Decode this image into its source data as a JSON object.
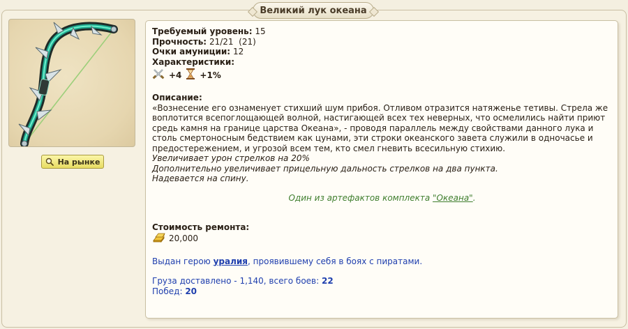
{
  "title": "Великий лук океана",
  "market_button": {
    "label": "На рынке"
  },
  "item": {
    "image_icon": "bow-icon",
    "required_level_label": "Требуемый уровень:",
    "required_level_value": "15",
    "durability_label": "Прочность:",
    "durability_value": "21/21  (21)",
    "ammo_label": "Очки амуниции:",
    "ammo_value": "12",
    "characteristics_label": "Характеристики:",
    "stats": [
      {
        "icon": "crossed-swords-icon",
        "value": "+4"
      },
      {
        "icon": "hourglass-icon",
        "value": "+1%"
      }
    ],
    "description_label": "Описание:",
    "description_text": "«Вознесение его ознаменует стихший шум прибоя. Отливом отразится натяженье тетивы. Стрела же воплотится всепоглощающей волной, настигающей всех тех неверных, что осмелились найти приют средь камня на границе царства Океана», - проводя параллель между свойствами данного лука и столь смертоносным бедствием как цунами, эти строки океанского завета служили в одночасье и предостережением, и угрозой всем тем, кто смел гневить всесильную стихию.",
    "effects": [
      "Увеличивает урон стрелков на 20%",
      "Дополнительно увеличивает прицельную дальность стрелков на два пункта.",
      "Надевается на спину."
    ],
    "set_prefix": "Один из артефактов комплекта ",
    "set_link": "\"Океана\"",
    "set_suffix": ".",
    "repair_label": "Стоимость ремонта:",
    "repair_icon": "gold-icon",
    "repair_value": "20,000",
    "issued_prefix": "Выдан герою ",
    "issued_hero": "уралия",
    "issued_suffix": ", проявившему себя в боях с пиратами.",
    "cargo_text": "Груза доставлено - 1,140, всего боев: ",
    "cargo_battles": "22",
    "wins_label": "Побед: ",
    "wins_value": "20"
  },
  "colors": {
    "background": "#f4efe0",
    "panel": "#fffdf7",
    "set_green": "#3f7e2e",
    "link_blue": "#1f3fae",
    "market_button": "#f0e680"
  }
}
